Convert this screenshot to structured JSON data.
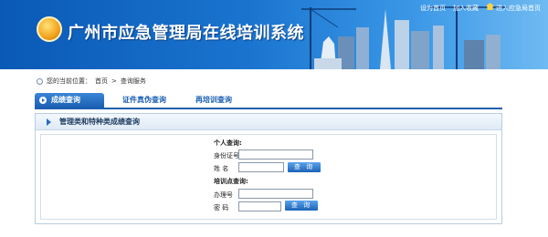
{
  "banner": {
    "title": "广州市应急管理局在线培训系统",
    "links": [
      "设为首页",
      "加入收藏",
      "进入应急局首页"
    ]
  },
  "breadcrumb": {
    "prefix": "您的当前位置：",
    "home": "首页",
    "separator": ">",
    "current": "查询服务"
  },
  "tabs": [
    {
      "label": "成绩查询",
      "active": true
    },
    {
      "label": "证件真伪查询",
      "active": false
    },
    {
      "label": "再培训查询",
      "active": false
    }
  ],
  "panel": {
    "title": "管理类和特种类成绩查询"
  },
  "form": {
    "personal": {
      "heading": "个人查询:",
      "id_label": "身份证号",
      "name_label": "姓  名",
      "button": "查 询"
    },
    "org": {
      "heading": "培训点查询:",
      "account_label": "办理号",
      "password_label": "密  码",
      "button": "查 询"
    }
  },
  "colors": {
    "accent": "#1b5fb2",
    "banner": "#1a74cf",
    "button": "#2a73c7"
  }
}
